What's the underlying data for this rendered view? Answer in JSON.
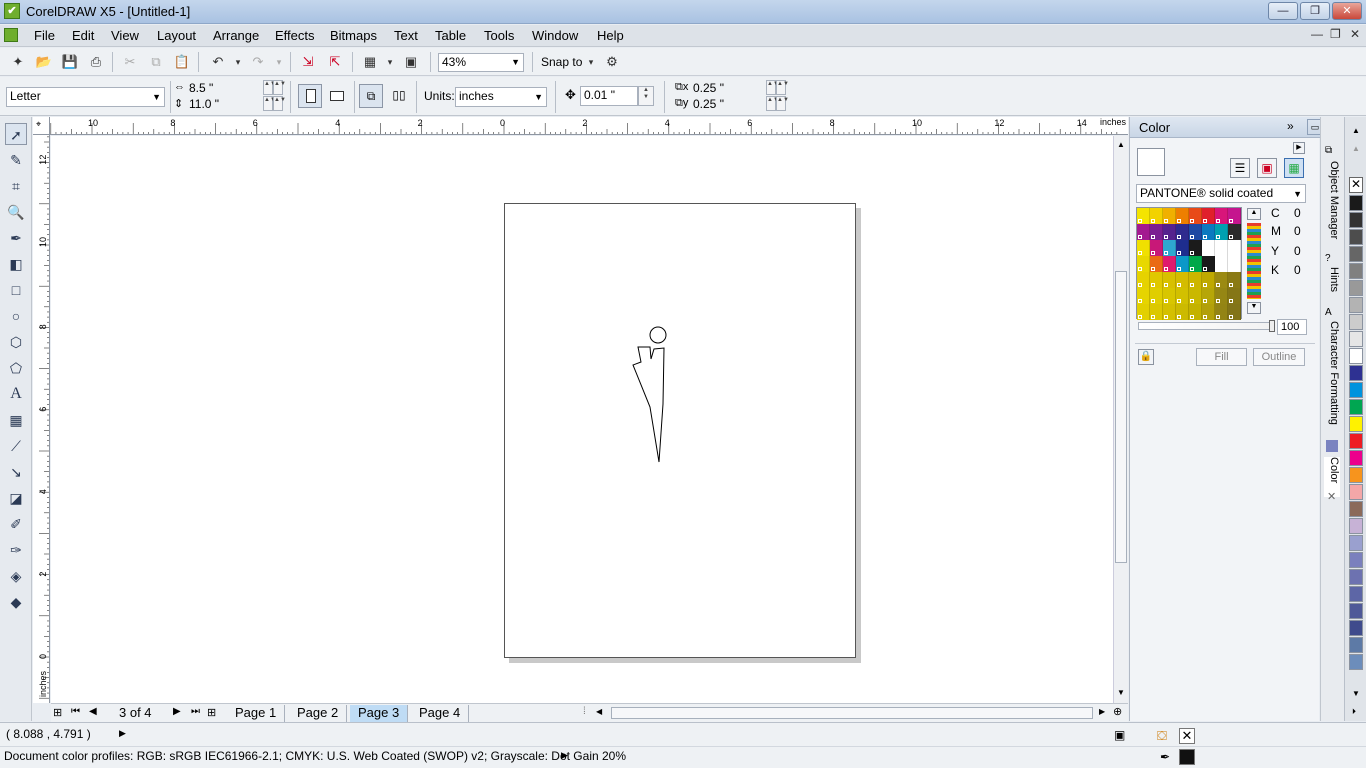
{
  "window": {
    "title": "CorelDRAW X5 - [Untitled-1]",
    "icon": "coreldraw-app-icon",
    "min": "—",
    "max": "❐",
    "close": "✕"
  },
  "menu": {
    "items": [
      "File",
      "Edit",
      "View",
      "Layout",
      "Arrange",
      "Effects",
      "Bitmaps",
      "Text",
      "Table",
      "Tools",
      "Window",
      "Help"
    ]
  },
  "toolbar": {
    "zoom": "43%",
    "snap_to": "Snap to"
  },
  "propbar": {
    "paper_size": "Letter",
    "width": "8.5 \"",
    "height": "11.0 \"",
    "units_label": "Units:",
    "units_value": "inches",
    "nudge": "0.01 \"",
    "dup_x": "0.25 \"",
    "dup_y": "0.25 \""
  },
  "ruler": {
    "units": "inches",
    "h_ticks": [
      "10",
      "8",
      "6",
      "4",
      "2",
      "0",
      "2",
      "4",
      "6",
      "8",
      "10",
      "12",
      "14"
    ],
    "v_ticks": [
      "12",
      "10",
      "8",
      "6",
      "4",
      "2",
      "0"
    ],
    "v_units": "inches"
  },
  "pages": {
    "counter": "3 of 4",
    "tabs": [
      "Page 1",
      "Page 2",
      "Page 3",
      "Page 4"
    ],
    "active": "Page 3"
  },
  "docker": {
    "title": "Color",
    "palette_name": "PANTONE® solid coated",
    "cmyk_labels": [
      "C",
      "M",
      "Y",
      "K"
    ],
    "cmyk_values": [
      "0",
      "0",
      "0",
      "0"
    ],
    "tint": "100",
    "fill_button": "Fill",
    "outline_button": "Outline",
    "swatch_colors": [
      [
        "#f4e400",
        "#f2d200",
        "#f0b000",
        "#ee7f00",
        "#e84a18",
        "#e0202c",
        "#d8157a",
        "#c5158e"
      ],
      [
        "#a31a90",
        "#7a1f92",
        "#55228e",
        "#2f2a8e",
        "#1e49a3",
        "#0b7ac0",
        "#00a0b0",
        "#2b2b2b"
      ],
      [
        "#f0e000",
        "#c81878",
        "#2ea8d0",
        "#1e2d8e",
        "#1b1b1b",
        "#ffffff",
        "#ffffff",
        "#ffffff"
      ],
      [
        "#e8d800",
        "#ea6a14",
        "#e01a6e",
        "#0b98c8",
        "#00a84a",
        "#1a1a1a",
        "#ffffff",
        "#ffffff"
      ],
      [
        "#e6d200",
        "#e0c800",
        "#d8c000",
        "#d4bc00",
        "#cdb600",
        "#bfa900",
        "#9b8a12",
        "#8a7a14"
      ],
      [
        "#e6d400",
        "#e0ce00",
        "#d8c600",
        "#d2c000",
        "#cab800",
        "#b6a608",
        "#958614",
        "#857616"
      ],
      [
        "#e2d000",
        "#dcc800",
        "#d4c000",
        "#ccba00",
        "#c4b200",
        "#b2a00a",
        "#938414",
        "#827418"
      ]
    ]
  },
  "side_tabs": [
    "Object Manager",
    "Hints",
    "Character Formatting",
    "Color"
  ],
  "palette": {
    "colors": [
      "#1a1a1a",
      "#333333",
      "#4d4d4d",
      "#666666",
      "#808080",
      "#999999",
      "#b3b3b3",
      "#cccccc",
      "#e6e6e6",
      "#ffffff",
      "#2e3192",
      "#0093dd",
      "#00a651",
      "#fff200",
      "#ed1c24",
      "#ec008c",
      "#f7941d",
      "#f4a7a8",
      "#8b6a5a",
      "#c7b2d6",
      "#9aa0cf",
      "#7b80bd",
      "#6d72b0",
      "#5d66a6",
      "#4f5998",
      "#3f4b8c",
      "#5d7aa6",
      "#6c8dbb"
    ]
  },
  "status": {
    "coords": "( 8.088 , 4.791 )",
    "color_profiles": "Document color profiles: RGB: sRGB IEC61966-2.1; CMYK: U.S. Web Coated (SWOP) v2; Grayscale: Dot Gain 20%"
  },
  "tools": [
    "pick-tool-icon",
    "shape-tool-icon",
    "crop-tool-icon",
    "zoom-tool-icon",
    "freehand-tool-icon",
    "smart-fill-icon",
    "rectangle-tool-icon",
    "ellipse-tool-icon",
    "polygon-tool-icon",
    "basic-shapes-icon",
    "text-tool-icon",
    "table-tool-icon",
    "dimension-tool-icon",
    "connector-tool-icon",
    "blend-tool-icon",
    "eyedropper-tool-icon",
    "outline-pen-icon",
    "fill-tool-icon",
    "interactive-fill-icon"
  ]
}
